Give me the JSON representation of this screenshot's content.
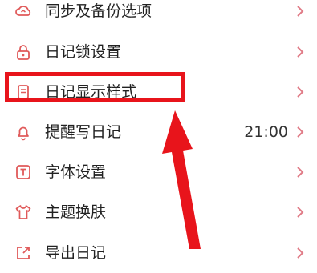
{
  "settings": {
    "items": [
      {
        "label": "同步及备份选项",
        "icon": "cloud-sync-icon"
      },
      {
        "label": "日记锁设置",
        "icon": "lock-icon"
      },
      {
        "label": "日记显示样式",
        "icon": "document-icon"
      },
      {
        "label": "提醒写日记",
        "icon": "bell-icon",
        "value": "21:00"
      },
      {
        "label": "字体设置",
        "icon": "font-icon"
      },
      {
        "label": "主题换肤",
        "icon": "tshirt-icon"
      },
      {
        "label": "导出日记",
        "icon": "export-icon"
      }
    ]
  },
  "colors": {
    "icon": "#e05a5a",
    "chevron": "#e07a86",
    "annotation": "#e8141b"
  }
}
